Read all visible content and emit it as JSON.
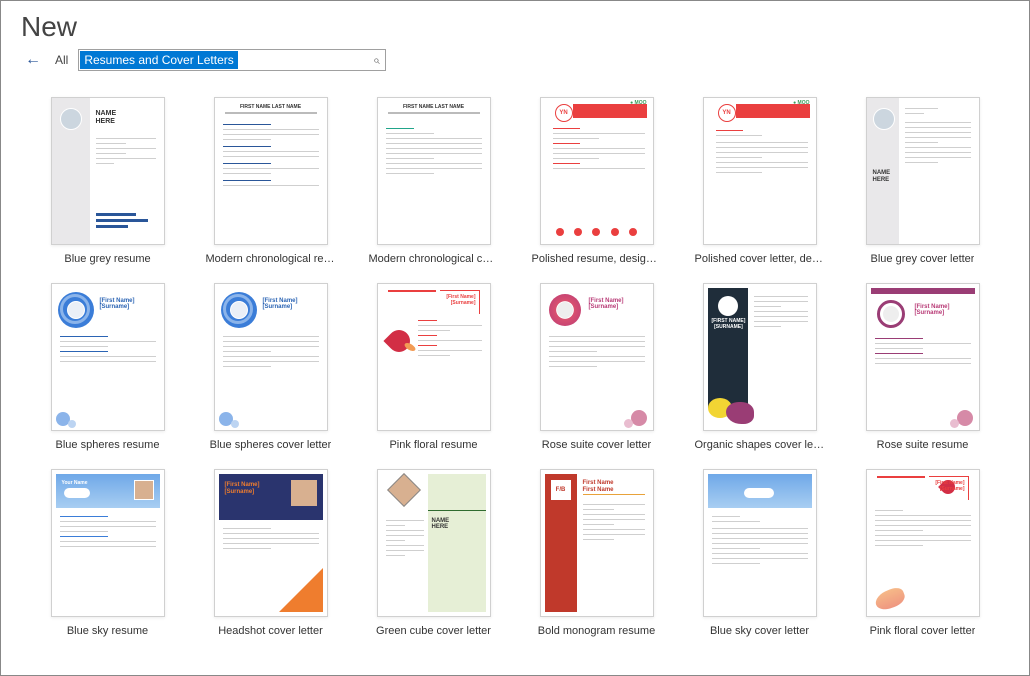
{
  "header": {
    "title": "New"
  },
  "search": {
    "back_label": "←",
    "filter_label": "All",
    "value": "Resumes and Cover Letters",
    "icon_glyph": "⌕"
  },
  "templates": [
    {
      "label": "Blue grey resume",
      "variant": "bluegrey"
    },
    {
      "label": "Modern chronological resume",
      "variant": "modernres"
    },
    {
      "label": "Modern chronological cover l...",
      "variant": "moderncl"
    },
    {
      "label": "Polished resume, designed b...",
      "variant": "polishedres"
    },
    {
      "label": "Polished cover letter, designe...",
      "variant": "polishedcl"
    },
    {
      "label": "Blue grey cover letter",
      "variant": "bluegreycl"
    },
    {
      "label": "Blue spheres resume",
      "variant": "spheresres"
    },
    {
      "label": "Blue spheres cover letter",
      "variant": "spherescl"
    },
    {
      "label": "Pink floral resume",
      "variant": "pinkfloralres"
    },
    {
      "label": "Rose suite cover letter",
      "variant": "rosecl"
    },
    {
      "label": "Organic shapes cover letter",
      "variant": "organiccl"
    },
    {
      "label": "Rose suite resume",
      "variant": "roseres"
    },
    {
      "label": "Blue sky resume",
      "variant": "blueskyres"
    },
    {
      "label": "Headshot cover letter",
      "variant": "headshotcl"
    },
    {
      "label": "Green cube cover letter",
      "variant": "greencubecl"
    },
    {
      "label": "Bold monogram resume",
      "variant": "boldmonores"
    },
    {
      "label": "Blue sky cover letter",
      "variant": "blueskycl"
    },
    {
      "label": "Pink floral cover letter",
      "variant": "pinkfloralcl"
    }
  ],
  "thumb_text": {
    "name_here": "NAME\nHERE",
    "first_last": "FIRST NAME LAST NAME",
    "yn": "YN",
    "moo": "● MOO",
    "fn_sn": "[First Name]\n[Surname]",
    "fb": "F/B"
  }
}
